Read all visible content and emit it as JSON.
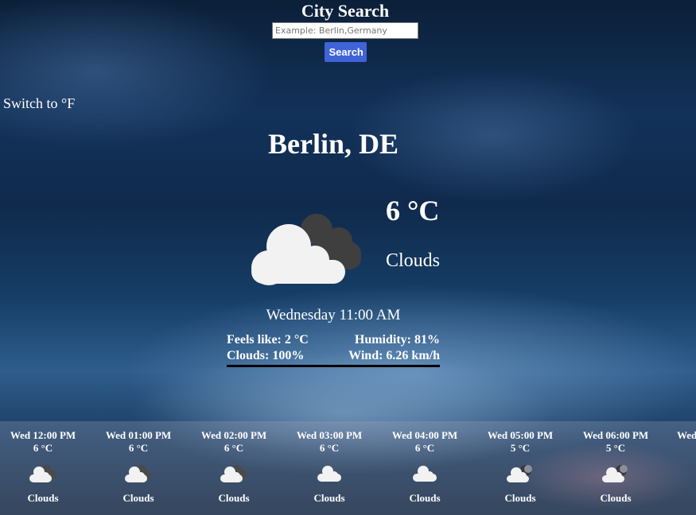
{
  "search": {
    "title": "City Search",
    "placeholder": "Example: Berlin,Germany",
    "button_label": "Search"
  },
  "unit_switch_label": "Switch to °F",
  "current": {
    "city": "Berlin, DE",
    "temperature": "6 °C",
    "condition": "Clouds",
    "icon": "broken-clouds-icon",
    "datetime": "Wednesday 11:00 AM",
    "feels_like": "Feels like: 2 °C",
    "humidity": "Humidity: 81%",
    "clouds": "Clouds: 100%",
    "wind": "Wind: 6.26 km/h"
  },
  "forecast": [
    {
      "time": "Wed 12:00 PM",
      "temp": "6 °C",
      "condition": "Clouds",
      "icon": "broken-clouds-icon"
    },
    {
      "time": "Wed 01:00 PM",
      "temp": "6 °C",
      "condition": "Clouds",
      "icon": "broken-clouds-icon"
    },
    {
      "time": "Wed 02:00 PM",
      "temp": "6 °C",
      "condition": "Clouds",
      "icon": "broken-clouds-icon"
    },
    {
      "time": "Wed 03:00 PM",
      "temp": "6 °C",
      "condition": "Clouds",
      "icon": "overcast-cloud-icon"
    },
    {
      "time": "Wed 04:00 PM",
      "temp": "6 °C",
      "condition": "Clouds",
      "icon": "overcast-cloud-icon"
    },
    {
      "time": "Wed 05:00 PM",
      "temp": "5 °C",
      "condition": "Clouds",
      "icon": "night-clouds-icon"
    },
    {
      "time": "Wed 06:00 PM",
      "temp": "5 °C",
      "condition": "Clouds",
      "icon": "night-clouds-icon"
    },
    {
      "time": "Wed",
      "temp": "",
      "condition": "",
      "icon": ""
    }
  ],
  "colors": {
    "search_button": "#3f64d8",
    "text": "#ffffff",
    "details_underline": "#000000"
  }
}
